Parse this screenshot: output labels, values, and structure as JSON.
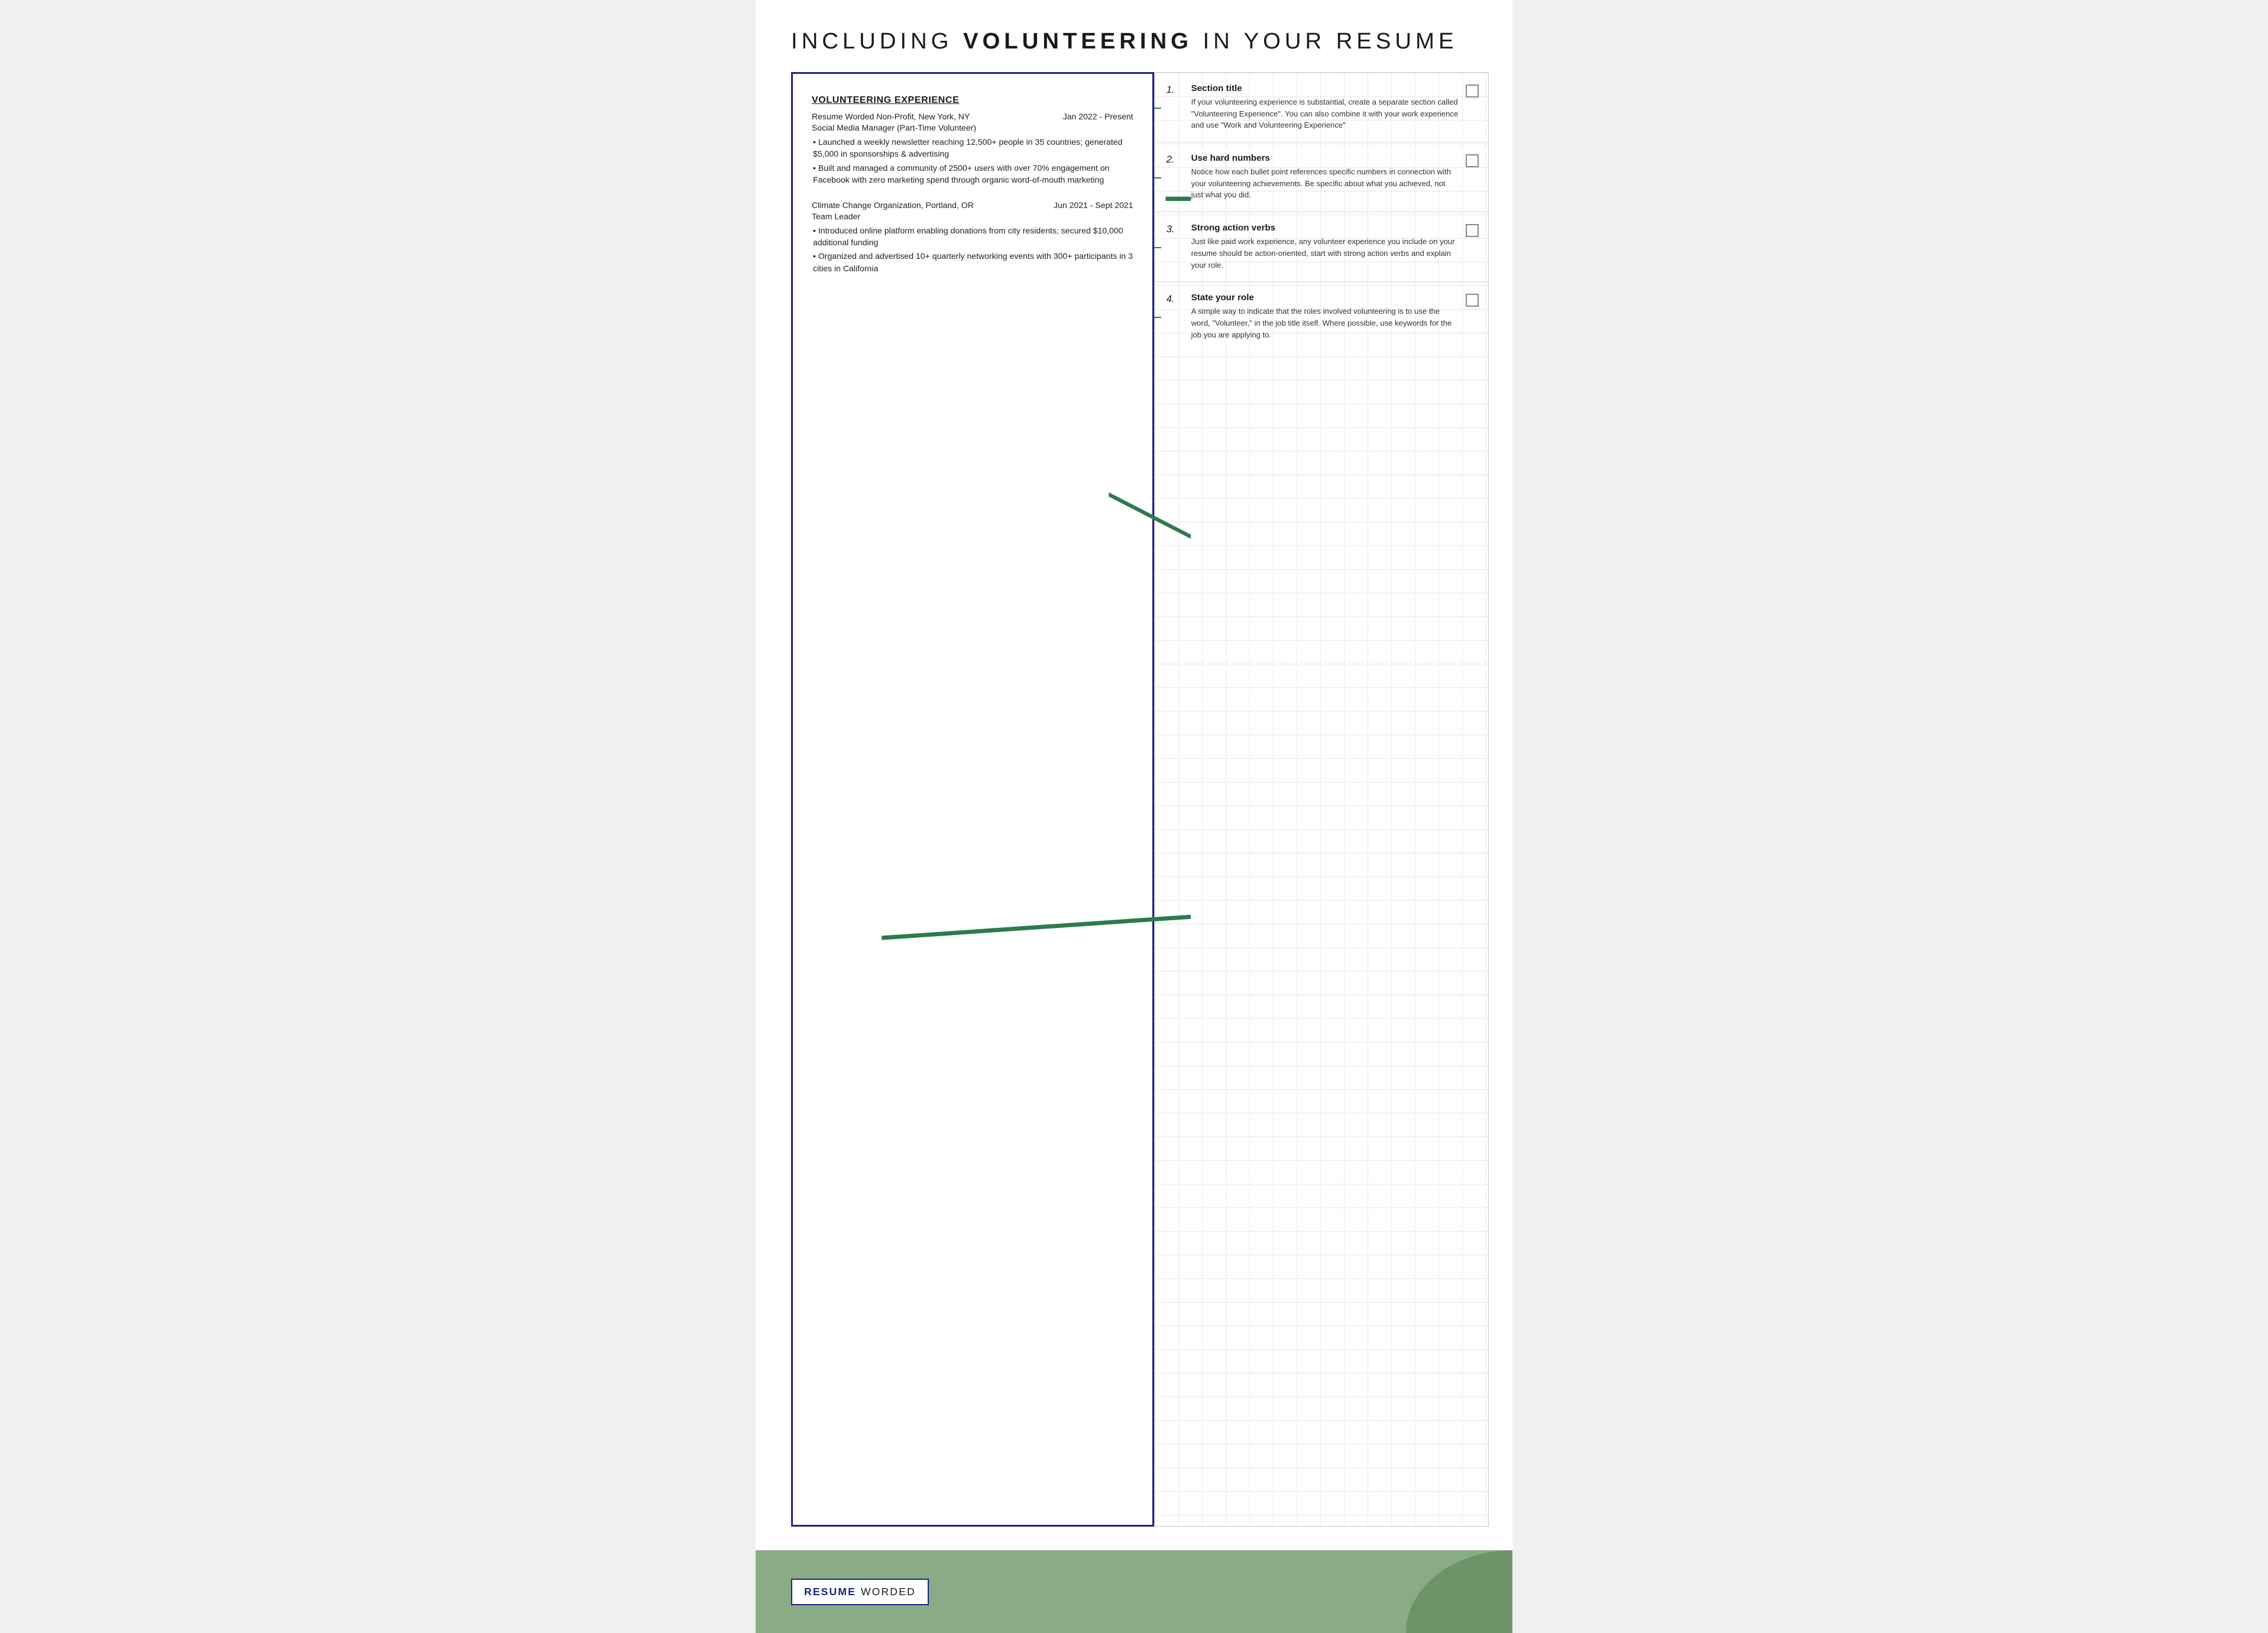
{
  "header": {
    "title_prefix": "INCLUDING ",
    "title_bold": "VOLUNTEERING",
    "title_suffix": " IN YOUR RESUME"
  },
  "resume": {
    "section_title": "VOLUNTEERING EXPERIENCE",
    "entries": [
      {
        "org": "Resume Worded Non-Profit, New York, NY",
        "date": "Jan 2022 - Present",
        "role": "Social Media Manager (Part-Time Volunteer)",
        "bullets": [
          "• Launched a weekly newsletter reaching 12,500+ people in 35 countries; generated $5,000 in sponsorships & advertising",
          "• Built and managed a community of 2500+ users with over 70% engagement on Facebook with zero marketing spend through organic word-of-mouth marketing"
        ]
      },
      {
        "org": "Climate Change Organization, Portland, OR",
        "date": "Jun 2021 - Sept 2021",
        "role": "Team Leader",
        "bullets": [
          "• Introduced online platform enabling donations from city residents; secured $10,000 additional funding",
          "• Organized and advertised 10+ quarterly networking events with 300+ participants in 3 cities in California"
        ]
      }
    ]
  },
  "tips": [
    {
      "number": "1.",
      "title": "Section title",
      "description": "If your volunteering experience is substantial, create a separate section called \"Volunteering Experience\". You can also combine it with your work experience and use \"Work and Volunteering Experience\""
    },
    {
      "number": "2.",
      "title": "Use hard numbers",
      "description": "Notice how each bullet point references specific numbers in connection with your volunteering achievements. Be specific about what you achieved, not just what you did."
    },
    {
      "number": "3.",
      "title": "Strong action verbs",
      "description": "Just like paid work experience, any volunteer experience you include on your resume should be action-oriented, start with strong action verbs and explain your role."
    },
    {
      "number": "4.",
      "title": "State your role",
      "description": "A simple way to indicate that the roles involved volunteering is to use the word, \"Volunteer,\" in the job title itself. Where possible, use keywords for the job you are applying to."
    }
  ],
  "brand": {
    "resume": "RESUME",
    "worded": "WORDED"
  }
}
